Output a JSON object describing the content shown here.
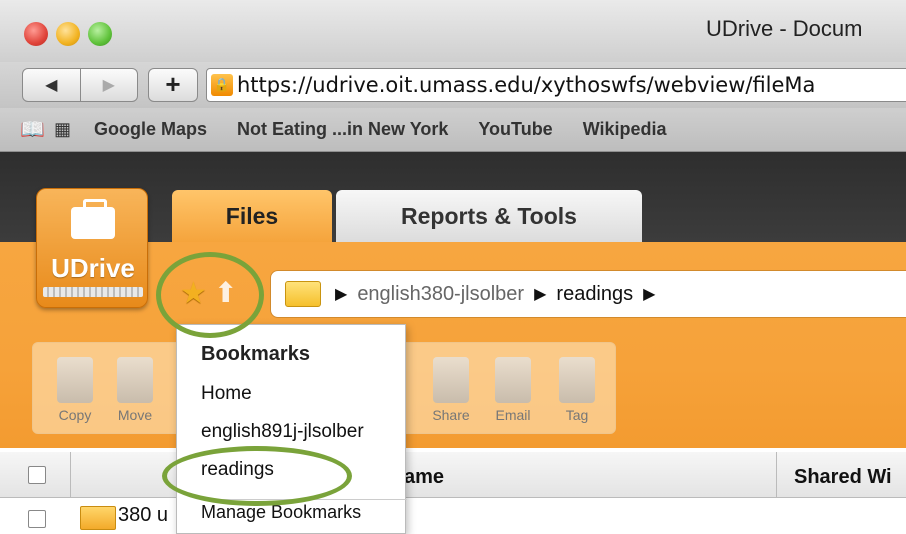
{
  "browser": {
    "window_title": "UDrive - Docum",
    "address": "https://udrive.oit.umass.edu/xythoswfs/webview/fileMa",
    "new_tab_label": "+",
    "back_label": "◀",
    "forward_label": "▶",
    "bookmarks_bar": [
      "Google Maps",
      "Not Eating ...in New York",
      "YouTube",
      "Wikipedia"
    ]
  },
  "app": {
    "logo_text": "UDrive",
    "tabs": [
      {
        "label": "Files",
        "active": true
      },
      {
        "label": "Reports & Tools",
        "active": false
      }
    ],
    "breadcrumb": [
      "english380-jlsolber",
      "readings"
    ],
    "toolbar": {
      "left_tools": [
        "Copy",
        "Move"
      ],
      "right_tools": [
        "Share",
        "Email",
        "Tag"
      ]
    }
  },
  "bookmarks_menu": {
    "title": "Bookmarks",
    "items": [
      "Home",
      "english891j-jlsolber",
      "readings"
    ],
    "manage_label": "Manage Bookmarks"
  },
  "file_list": {
    "columns": [
      "ame",
      "Shared Wi"
    ],
    "rows": [
      {
        "name": "380 u"
      }
    ]
  },
  "colors": {
    "accent_orange": "#f6a23a",
    "highlight_green": "#7aa33a"
  }
}
